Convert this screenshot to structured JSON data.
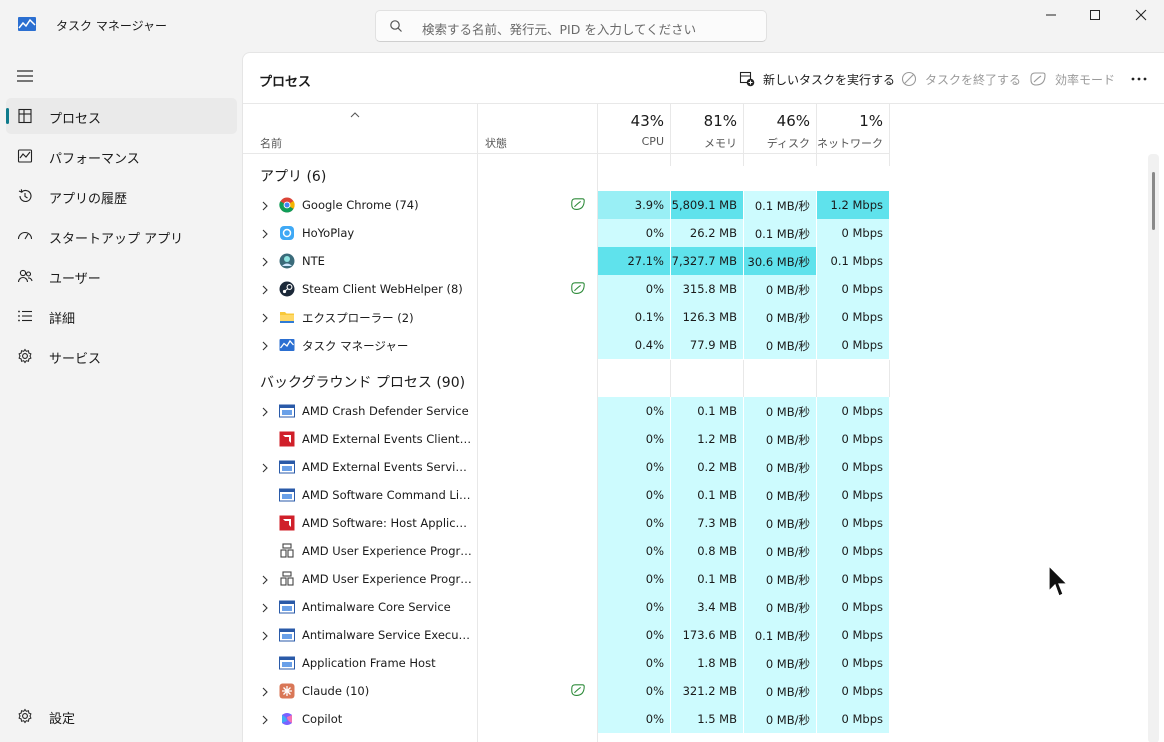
{
  "window": {
    "title": "タスク マネージャー"
  },
  "search": {
    "placeholder": "検索する名前、発行元、PID を入力してください"
  },
  "sidebar": {
    "items": [
      {
        "label": "プロセス"
      },
      {
        "label": "パフォーマンス"
      },
      {
        "label": "アプリの履歴"
      },
      {
        "label": "スタートアップ アプリ"
      },
      {
        "label": "ユーザー"
      },
      {
        "label": "詳細"
      },
      {
        "label": "サービス"
      }
    ],
    "settings": "設定"
  },
  "page": {
    "title": "プロセス"
  },
  "toolbar": {
    "new_task": "新しいタスクを実行する",
    "end_task": "タスクを終了する",
    "efficiency": "効率モード"
  },
  "columns": {
    "name": "名前",
    "status": "状態",
    "cpu": {
      "pct": "43%",
      "label": "CPU"
    },
    "memory": {
      "pct": "81%",
      "label": "メモリ"
    },
    "disk": {
      "pct": "46%",
      "label": "ディスク"
    },
    "network": {
      "pct": "1%",
      "label": "ネットワーク"
    }
  },
  "groups": {
    "apps": "アプリ (6)",
    "background": "バックグラウンド プロセス (90)"
  },
  "apps": [
    {
      "name": "Google Chrome (74)",
      "cpu": "3.9%",
      "mem": "5,809.1 MB",
      "disk": "0.1 MB/秒",
      "net": "1.2 Mbps",
      "icon": "chrome-icon"
    },
    {
      "name": "HoYoPlay",
      "cpu": "0%",
      "mem": "26.2 MB",
      "disk": "0.1 MB/秒",
      "net": "0 Mbps",
      "icon": "hoyoplay-icon"
    },
    {
      "name": "NTE",
      "cpu": "27.1%",
      "mem": "7,327.7 MB",
      "disk": "30.6 MB/秒",
      "net": "0.1 Mbps",
      "icon": "nte-icon"
    },
    {
      "name": "Steam Client WebHelper (8)",
      "cpu": "0%",
      "mem": "315.8 MB",
      "disk": "0 MB/秒",
      "net": "0 Mbps",
      "icon": "steam-icon"
    },
    {
      "name": "エクスプローラー (2)",
      "cpu": "0.1%",
      "mem": "126.3 MB",
      "disk": "0 MB/秒",
      "net": "0 Mbps",
      "icon": "folder-icon"
    },
    {
      "name": "タスク マネージャー",
      "cpu": "0.4%",
      "mem": "77.9 MB",
      "disk": "0 MB/秒",
      "net": "0 Mbps",
      "icon": "taskmgr-icon"
    }
  ],
  "background": [
    {
      "name": "AMD Crash Defender Service",
      "cpu": "0%",
      "mem": "0.1 MB",
      "disk": "0 MB/秒",
      "net": "0 Mbps",
      "icon": "service-icon"
    },
    {
      "name": "AMD External Events Client M...",
      "cpu": "0%",
      "mem": "1.2 MB",
      "disk": "0 MB/秒",
      "net": "0 Mbps",
      "icon": "amd-icon"
    },
    {
      "name": "AMD External Events Service ...",
      "cpu": "0%",
      "mem": "0.2 MB",
      "disk": "0 MB/秒",
      "net": "0 Mbps",
      "icon": "service-icon"
    },
    {
      "name": "AMD Software Command Line...",
      "cpu": "0%",
      "mem": "0.1 MB",
      "disk": "0 MB/秒",
      "net": "0 Mbps",
      "icon": "service-icon"
    },
    {
      "name": "AMD Software: Host Applicati...",
      "cpu": "0%",
      "mem": "7.3 MB",
      "disk": "0 MB/秒",
      "net": "0 Mbps",
      "icon": "amd-icon"
    },
    {
      "name": "AMD User Experience Progra...",
      "cpu": "0%",
      "mem": "0.8 MB",
      "disk": "0 MB/秒",
      "net": "0 Mbps",
      "icon": "cube-icon"
    },
    {
      "name": "AMD User Experience Progra...",
      "cpu": "0%",
      "mem": "0.1 MB",
      "disk": "0 MB/秒",
      "net": "0 Mbps",
      "icon": "cube-icon"
    },
    {
      "name": "Antimalware Core Service",
      "cpu": "0%",
      "mem": "3.4 MB",
      "disk": "0 MB/秒",
      "net": "0 Mbps",
      "icon": "service-icon"
    },
    {
      "name": "Antimalware Service Executable",
      "cpu": "0%",
      "mem": "173.6 MB",
      "disk": "0.1 MB/秒",
      "net": "0 Mbps",
      "icon": "service-icon"
    },
    {
      "name": "Application Frame Host",
      "cpu": "0%",
      "mem": "1.8 MB",
      "disk": "0 MB/秒",
      "net": "0 Mbps",
      "icon": "service-icon"
    },
    {
      "name": "Claude (10)",
      "cpu": "0%",
      "mem": "321.2 MB",
      "disk": "0 MB/秒",
      "net": "0 Mbps",
      "icon": "claude-icon"
    },
    {
      "name": "Copilot",
      "cpu": "0%",
      "mem": "1.5 MB",
      "disk": "0 MB/秒",
      "net": "0 Mbps",
      "icon": "copilot-icon"
    }
  ]
}
